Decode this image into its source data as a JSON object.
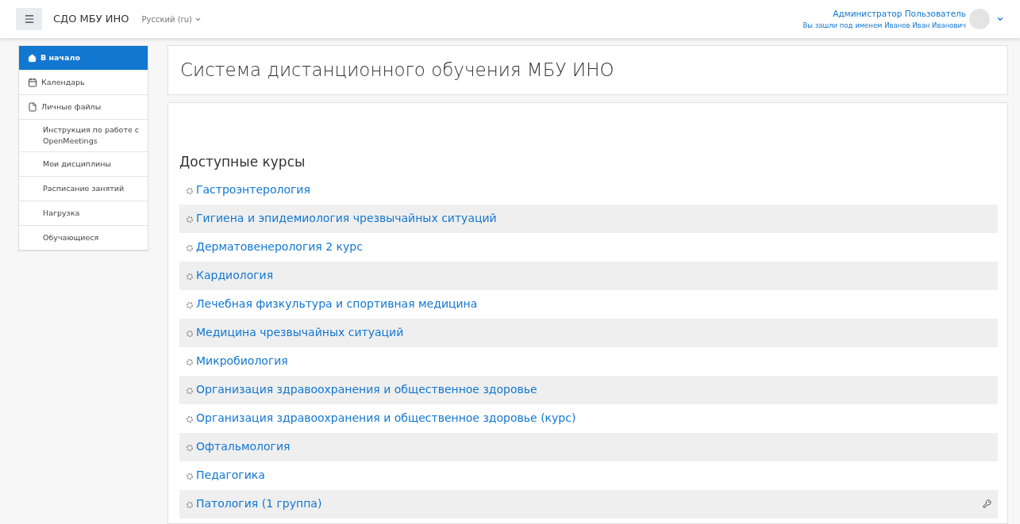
{
  "navbar": {
    "brand": "СДО МБУ ИНО",
    "language": "Русский (ru)",
    "user_name": "Администратор Пользователь",
    "logged_as": "Вы зашли под именем Иванов Иван Иванович"
  },
  "sidebar": {
    "items": [
      {
        "label": "В начало",
        "kind": "home",
        "selected": true
      },
      {
        "label": "Календарь",
        "kind": "calendar",
        "selected": false
      },
      {
        "label": "Личные файлы",
        "kind": "file",
        "selected": false
      },
      {
        "label": "Инструкция по работе с OpenMeetings",
        "kind": "plain",
        "selected": false
      },
      {
        "label": "Мои дисциплины",
        "kind": "plain",
        "selected": false
      },
      {
        "label": "Расписание занятий",
        "kind": "plain",
        "selected": false
      },
      {
        "label": "Нагрузка",
        "kind": "plain",
        "selected": false
      },
      {
        "label": "Обучающиеся",
        "kind": "plain",
        "selected": false
      }
    ]
  },
  "page_title": "Система дистанционного обучения МБУ ИНО",
  "courses": {
    "heading": "Доступные курсы",
    "items": [
      {
        "name": "Гастроэнтерология",
        "key": false
      },
      {
        "name": "Гигиена и эпидемиология чрезвычайных ситуаций",
        "key": false
      },
      {
        "name": "Дерматовенерология 2 курс",
        "key": false
      },
      {
        "name": "Кардиология",
        "key": false
      },
      {
        "name": "Лечебная физкультура и спортивная медицина",
        "key": false
      },
      {
        "name": "Медицина чрезвычайных ситуаций",
        "key": false
      },
      {
        "name": "Микробиология",
        "key": false
      },
      {
        "name": "Организация здравоохранения и общественное здоровье",
        "key": false
      },
      {
        "name": "Организация здравоохранения и общественное здоровье (курс)",
        "key": false
      },
      {
        "name": "Офтальмология",
        "key": false
      },
      {
        "name": "Педагогика",
        "key": false
      },
      {
        "name": "Патология (1 группа)",
        "key": true
      }
    ]
  }
}
